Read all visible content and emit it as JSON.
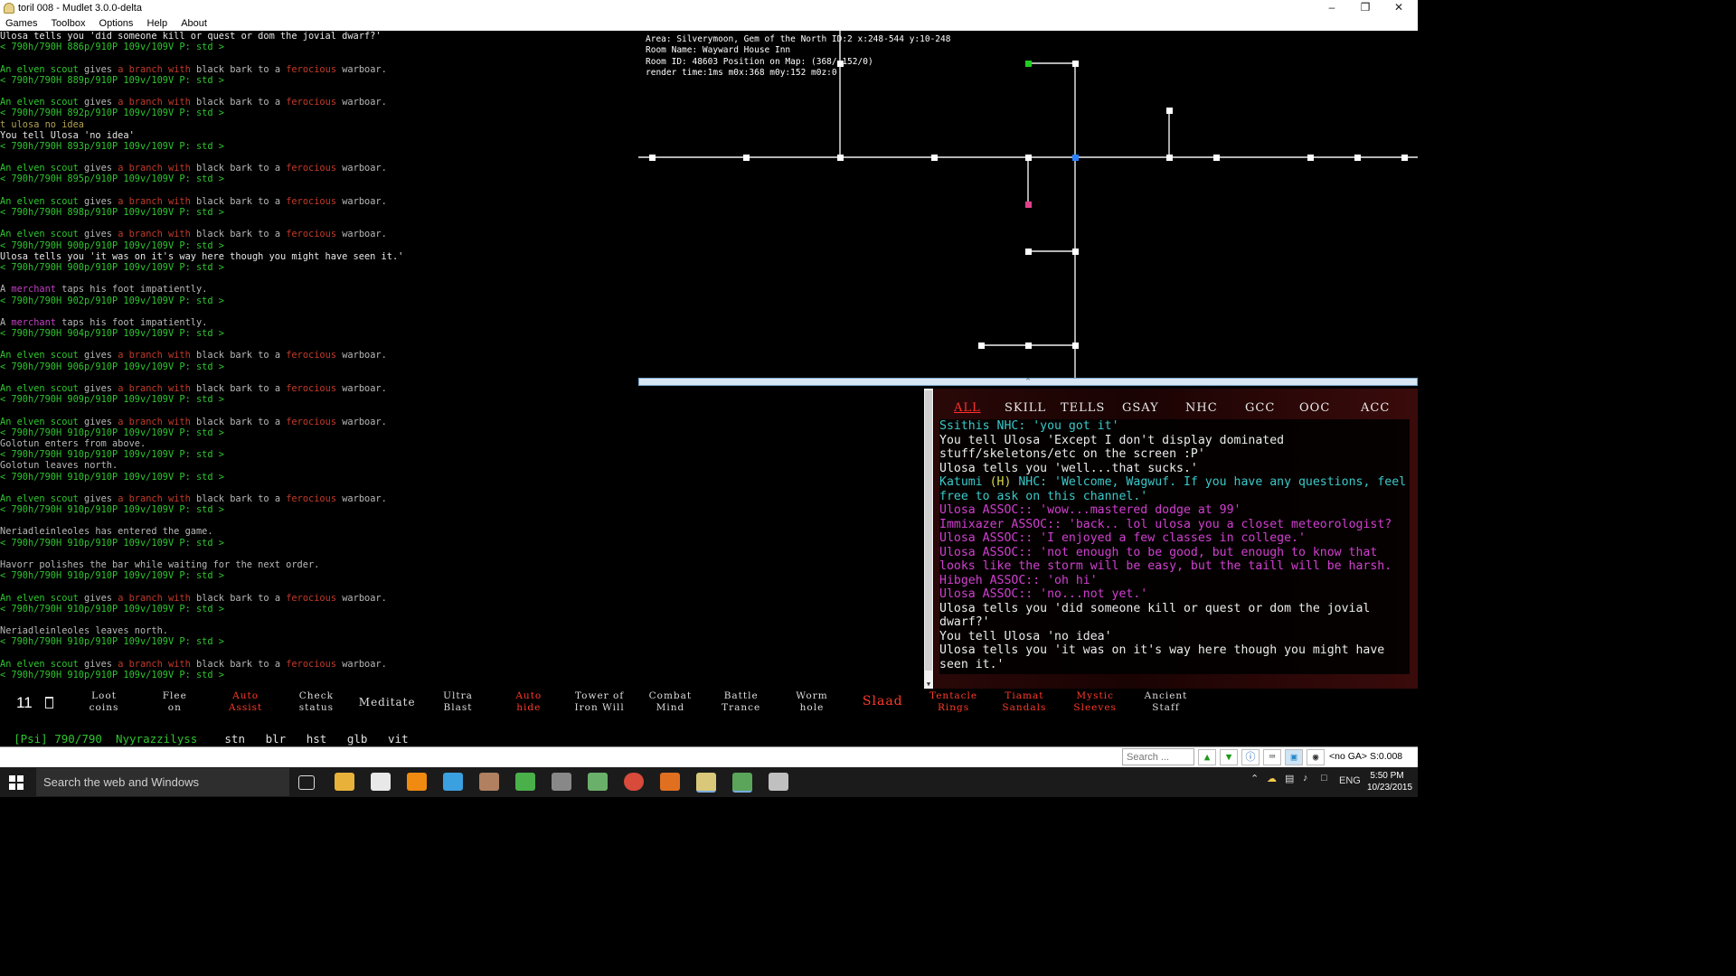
{
  "window": {
    "title": "toril 008 - Mudlet 3.0.0-delta"
  },
  "menu": [
    "Games",
    "Toolbox",
    "Options",
    "Help",
    "About"
  ],
  "main_output": [
    [
      {
        "t": "Ulosa tells you 'did someone kill or quest or dom the jovial dwarf?'",
        "c": "wt"
      }
    ],
    [
      {
        "t": "< 790h/790H 886p/910P 109v/109V P: std >",
        "c": "gr"
      }
    ],
    [],
    [
      {
        "t": "An elven scout",
        "c": "gr"
      },
      {
        "t": " gives ",
        "c": "gy"
      },
      {
        "t": "a branch with ",
        "c": "rd"
      },
      {
        "t": "black bark",
        "c": "gy"
      },
      {
        "t": " to ",
        "c": "gy"
      },
      {
        "t": "a ",
        "c": "gy"
      },
      {
        "t": "ferocious",
        "c": "rd"
      },
      {
        "t": " warboar.",
        "c": "gy"
      }
    ],
    [
      {
        "t": "< 790h/790H 889p/910P 109v/109V P: std >",
        "c": "gr"
      }
    ],
    [],
    [
      {
        "t": "An elven scout",
        "c": "gr"
      },
      {
        "t": " gives ",
        "c": "gy"
      },
      {
        "t": "a branch with ",
        "c": "rd"
      },
      {
        "t": "black bark",
        "c": "gy"
      },
      {
        "t": " to ",
        "c": "gy"
      },
      {
        "t": "a ",
        "c": "gy"
      },
      {
        "t": "ferocious",
        "c": "rd"
      },
      {
        "t": " warboar.",
        "c": "gy"
      }
    ],
    [
      {
        "t": "< 790h/790H 892p/910P 109v/109V P: std >",
        "c": "gr"
      }
    ],
    [
      {
        "t": "t ulosa no idea",
        "c": "ol"
      }
    ],
    [
      {
        "t": "You tell Ulosa 'no idea'",
        "c": "wt"
      }
    ],
    [
      {
        "t": "< 790h/790H 893p/910P 109v/109V P: std >",
        "c": "gr"
      }
    ],
    [],
    [
      {
        "t": "An elven scout",
        "c": "gr"
      },
      {
        "t": " gives ",
        "c": "gy"
      },
      {
        "t": "a branch with ",
        "c": "rd"
      },
      {
        "t": "black bark",
        "c": "gy"
      },
      {
        "t": " to ",
        "c": "gy"
      },
      {
        "t": "a ",
        "c": "gy"
      },
      {
        "t": "ferocious",
        "c": "rd"
      },
      {
        "t": " warboar.",
        "c": "gy"
      }
    ],
    [
      {
        "t": "< 790h/790H 895p/910P 109v/109V P: std >",
        "c": "gr"
      }
    ],
    [],
    [
      {
        "t": "An elven scout",
        "c": "gr"
      },
      {
        "t": " gives ",
        "c": "gy"
      },
      {
        "t": "a branch with ",
        "c": "rd"
      },
      {
        "t": "black bark",
        "c": "gy"
      },
      {
        "t": " to ",
        "c": "gy"
      },
      {
        "t": "a ",
        "c": "gy"
      },
      {
        "t": "ferocious",
        "c": "rd"
      },
      {
        "t": " warboar.",
        "c": "gy"
      }
    ],
    [
      {
        "t": "< 790h/790H 898p/910P 109v/109V P: std >",
        "c": "gr"
      }
    ],
    [],
    [
      {
        "t": "An elven scout",
        "c": "gr"
      },
      {
        "t": " gives ",
        "c": "gy"
      },
      {
        "t": "a branch with ",
        "c": "rd"
      },
      {
        "t": "black bark",
        "c": "gy"
      },
      {
        "t": " to ",
        "c": "gy"
      },
      {
        "t": "a ",
        "c": "gy"
      },
      {
        "t": "ferocious",
        "c": "rd"
      },
      {
        "t": " warboar.",
        "c": "gy"
      }
    ],
    [
      {
        "t": "< 790h/790H 900p/910P 109v/109V P: std >",
        "c": "gr"
      }
    ],
    [
      {
        "t": "Ulosa tells you 'it was on it's way here though you might have seen it.'",
        "c": "wt"
      }
    ],
    [
      {
        "t": "< 790h/790H 900p/910P 109v/109V P: std >",
        "c": "gr"
      }
    ],
    [],
    [
      {
        "t": "A ",
        "c": "gy"
      },
      {
        "t": "merchant",
        "c": "mg"
      },
      {
        "t": " taps his foot impatiently.",
        "c": "gy"
      }
    ],
    [
      {
        "t": "< 790h/790H 902p/910P 109v/109V P: std >",
        "c": "gr"
      }
    ],
    [],
    [
      {
        "t": "A ",
        "c": "gy"
      },
      {
        "t": "merchant",
        "c": "mg"
      },
      {
        "t": " taps his foot impatiently.",
        "c": "gy"
      }
    ],
    [
      {
        "t": "< 790h/790H 904p/910P 109v/109V P: std >",
        "c": "gr"
      }
    ],
    [],
    [
      {
        "t": "An elven scout",
        "c": "gr"
      },
      {
        "t": " gives ",
        "c": "gy"
      },
      {
        "t": "a branch with ",
        "c": "rd"
      },
      {
        "t": "black bark",
        "c": "gy"
      },
      {
        "t": " to ",
        "c": "gy"
      },
      {
        "t": "a ",
        "c": "gy"
      },
      {
        "t": "ferocious",
        "c": "rd"
      },
      {
        "t": " warboar.",
        "c": "gy"
      }
    ],
    [
      {
        "t": "< 790h/790H 906p/910P 109v/109V P: std >",
        "c": "gr"
      }
    ],
    [],
    [
      {
        "t": "An elven scout",
        "c": "gr"
      },
      {
        "t": " gives ",
        "c": "gy"
      },
      {
        "t": "a branch with ",
        "c": "rd"
      },
      {
        "t": "black bark",
        "c": "gy"
      },
      {
        "t": " to ",
        "c": "gy"
      },
      {
        "t": "a ",
        "c": "gy"
      },
      {
        "t": "ferocious",
        "c": "rd"
      },
      {
        "t": " warboar.",
        "c": "gy"
      }
    ],
    [
      {
        "t": "< 790h/790H 909p/910P 109v/109V P: std >",
        "c": "gr"
      }
    ],
    [],
    [
      {
        "t": "An elven scout",
        "c": "gr"
      },
      {
        "t": " gives ",
        "c": "gy"
      },
      {
        "t": "a branch with ",
        "c": "rd"
      },
      {
        "t": "black bark",
        "c": "gy"
      },
      {
        "t": " to ",
        "c": "gy"
      },
      {
        "t": "a ",
        "c": "gy"
      },
      {
        "t": "ferocious",
        "c": "rd"
      },
      {
        "t": " warboar.",
        "c": "gy"
      }
    ],
    [
      {
        "t": "< 790h/790H 910p/910P 109v/109V P: std >",
        "c": "gr"
      }
    ],
    [
      {
        "t": "Golotun enters from above.",
        "c": "gy"
      }
    ],
    [
      {
        "t": "< 790h/790H 910p/910P 109v/109V P: std >",
        "c": "gr"
      }
    ],
    [
      {
        "t": "Golotun leaves north.",
        "c": "gy"
      }
    ],
    [
      {
        "t": "< 790h/790H 910p/910P 109v/109V P: std >",
        "c": "gr"
      }
    ],
    [],
    [
      {
        "t": "An elven scout",
        "c": "gr"
      },
      {
        "t": " gives ",
        "c": "gy"
      },
      {
        "t": "a branch with ",
        "c": "rd"
      },
      {
        "t": "black bark",
        "c": "gy"
      },
      {
        "t": " to ",
        "c": "gy"
      },
      {
        "t": "a ",
        "c": "gy"
      },
      {
        "t": "ferocious",
        "c": "rd"
      },
      {
        "t": " warboar.",
        "c": "gy"
      }
    ],
    [
      {
        "t": "< 790h/790H 910p/910P 109v/109V P: std >",
        "c": "gr"
      }
    ],
    [],
    [
      {
        "t": "Neriadleinleoles has entered the game.",
        "c": "gy"
      }
    ],
    [
      {
        "t": "< 790h/790H 910p/910P 109v/109V P: std >",
        "c": "gr"
      }
    ],
    [],
    [
      {
        "t": "Havorr polishes the bar while waiting for the next order.",
        "c": "gy"
      }
    ],
    [
      {
        "t": "< 790h/790H 910p/910P 109v/109V P: std >",
        "c": "gr"
      }
    ],
    [],
    [
      {
        "t": "An elven scout",
        "c": "gr"
      },
      {
        "t": " gives ",
        "c": "gy"
      },
      {
        "t": "a branch with ",
        "c": "rd"
      },
      {
        "t": "black bark",
        "c": "gy"
      },
      {
        "t": " to ",
        "c": "gy"
      },
      {
        "t": "a ",
        "c": "gy"
      },
      {
        "t": "ferocious",
        "c": "rd"
      },
      {
        "t": " warboar.",
        "c": "gy"
      }
    ],
    [
      {
        "t": "< 790h/790H 910p/910P 109v/109V P: std >",
        "c": "gr"
      }
    ],
    [],
    [
      {
        "t": "Neriadleinleoles leaves north.",
        "c": "gy"
      }
    ],
    [
      {
        "t": "< 790h/790H 910p/910P 109v/109V P: std >",
        "c": "gr"
      }
    ],
    [],
    [
      {
        "t": "An elven scout",
        "c": "gr"
      },
      {
        "t": " gives ",
        "c": "gy"
      },
      {
        "t": "a branch with ",
        "c": "rd"
      },
      {
        "t": "black bark",
        "c": "gy"
      },
      {
        "t": " to ",
        "c": "gy"
      },
      {
        "t": "a ",
        "c": "gy"
      },
      {
        "t": "ferocious",
        "c": "rd"
      },
      {
        "t": " warboar.",
        "c": "gy"
      }
    ],
    [
      {
        "t": "< 790h/790H 910p/910P 109v/109V P: std >",
        "c": "gr"
      }
    ]
  ],
  "map": {
    "info": [
      "Area: Silverymoon, Gem of the North ID:2 x:248-544 y:10-248",
      "Room Name: Wayward House Inn",
      "Room ID: 48603 Position on Map: (368/-152/0)",
      "render time:1ms m0x:368 m0y:152 m0z:0"
    ],
    "current_room_color": "#2a7fff",
    "marked_room_color": "#22cc22",
    "special_room_color": "#e0408a"
  },
  "chat": {
    "tabs": [
      "ALL",
      "SKILL",
      "TELLS",
      "GSAY",
      "NHC",
      "GCC",
      "OOC",
      "ACC"
    ],
    "active_tab": "ALL",
    "lines": [
      [
        {
          "t": "Ssithis ",
          "c": "cc"
        },
        {
          "t": "NHC: 'you got it'",
          "c": "cc"
        }
      ],
      [
        {
          "t": "You tell Ulosa 'Except I don't display dominated stuff/skeletons/etc on the screen :P'",
          "c": "cw"
        }
      ],
      [
        {
          "t": "Ulosa tells you 'well...that sucks.'",
          "c": "cw"
        }
      ],
      [
        {
          "t": "Katumi ",
          "c": "cc"
        },
        {
          "t": "(H) ",
          "c": "cy"
        },
        {
          "t": "NHC: 'Welcome, Wagwuf. If you have any questions, feel free to ask on this channel.'",
          "c": "cc"
        }
      ],
      [
        {
          "t": "Ulosa ",
          "c": "cm"
        },
        {
          "t": "ASSOC:: 'wow...mastered dodge at 99'",
          "c": "cm"
        }
      ],
      [
        {
          "t": "Immixazer ",
          "c": "cm"
        },
        {
          "t": "ASSOC:: 'back.. lol ulosa you a closet meteorologist?",
          "c": "cm"
        }
      ],
      [
        {
          "t": "Ulosa ",
          "c": "cm"
        },
        {
          "t": "ASSOC:: 'I enjoyed a few classes in college.'",
          "c": "cm"
        }
      ],
      [
        {
          "t": "Ulosa ",
          "c": "cm"
        },
        {
          "t": "ASSOC:: 'not enough to be good, but enough to know that looks like the storm will be easy, but the taill will be harsh.",
          "c": "cm"
        }
      ],
      [
        {
          "t": "Hibgeh ",
          "c": "cm"
        },
        {
          "t": "ASSOC:: 'oh hi'",
          "c": "cm"
        }
      ],
      [
        {
          "t": "Ulosa ",
          "c": "cm"
        },
        {
          "t": "ASSOC:: 'no...not yet.'",
          "c": "cm"
        }
      ],
      [
        {
          "t": "Ulosa tells you 'did someone kill or quest or dom the jovial dwarf?'",
          "c": "cw"
        }
      ],
      [
        {
          "t": "You tell Ulosa 'no idea'",
          "c": "cw"
        }
      ],
      [
        {
          "t": "Ulosa tells you 'it was on it's way here though you might have seen it.'",
          "c": "cw"
        }
      ]
    ]
  },
  "button_bar": {
    "counter": "11",
    "buttons": [
      {
        "label": "Loot\ncoins",
        "red": false
      },
      {
        "label": "Flee\non",
        "red": false
      },
      {
        "label": "Auto\nAssist",
        "red": true
      },
      {
        "label": "Check\nstatus",
        "red": false
      },
      {
        "label": "Meditate",
        "red": false
      },
      {
        "label": "Ultra\nBlast",
        "red": false
      },
      {
        "label": "Auto\nhide",
        "red": true
      },
      {
        "label": "Tower of\nIron Will",
        "red": false
      },
      {
        "label": "Combat\nMind",
        "red": false
      },
      {
        "label": "Battle\nTrance",
        "red": false
      },
      {
        "label": "Worm\nhole",
        "red": false
      },
      {
        "label": "Slaad",
        "red": true
      },
      {
        "label": "Tentacle\nRings",
        "red": true
      },
      {
        "label": "Tiamat\nSandals",
        "red": true
      },
      {
        "label": "Mystic\nSleeves",
        "red": true
      },
      {
        "label": "Ancient\nStaff",
        "red": false
      }
    ]
  },
  "status_line": {
    "cls": "[Psi]",
    "hp": "790/790",
    "name": "Nyyrazzilyss",
    "spells": [
      "stn",
      "blr",
      "hst",
      "glb",
      "vit"
    ]
  },
  "input": {
    "value": "",
    "search_placeholder": "Search ...",
    "status": "<no GA> S:0.008"
  },
  "taskbar": {
    "search_placeholder": "Search the web and Windows",
    "lang": "ENG",
    "time": "5:50 PM",
    "date": "10/23/2015"
  }
}
